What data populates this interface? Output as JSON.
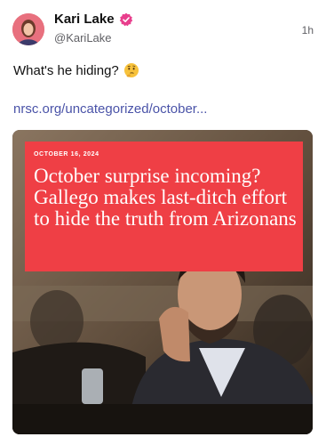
{
  "post": {
    "author_name": "Kari Lake",
    "author_handle": "@KariLake",
    "timestamp": "1h",
    "text": "What's he hiding?",
    "text_emoji": "thinking-face-emoji",
    "link_text": "nrsc.org/uncategorized/october...",
    "verified_color": "#e83e8c",
    "link_color": "#4a53a8"
  },
  "card": {
    "date": "OCTOBER 16, 2024",
    "headline": "October surprise incoming? Gallego makes last-ditch effort to hide the truth from Arizonans",
    "headline_bg": "#ef3f45"
  }
}
